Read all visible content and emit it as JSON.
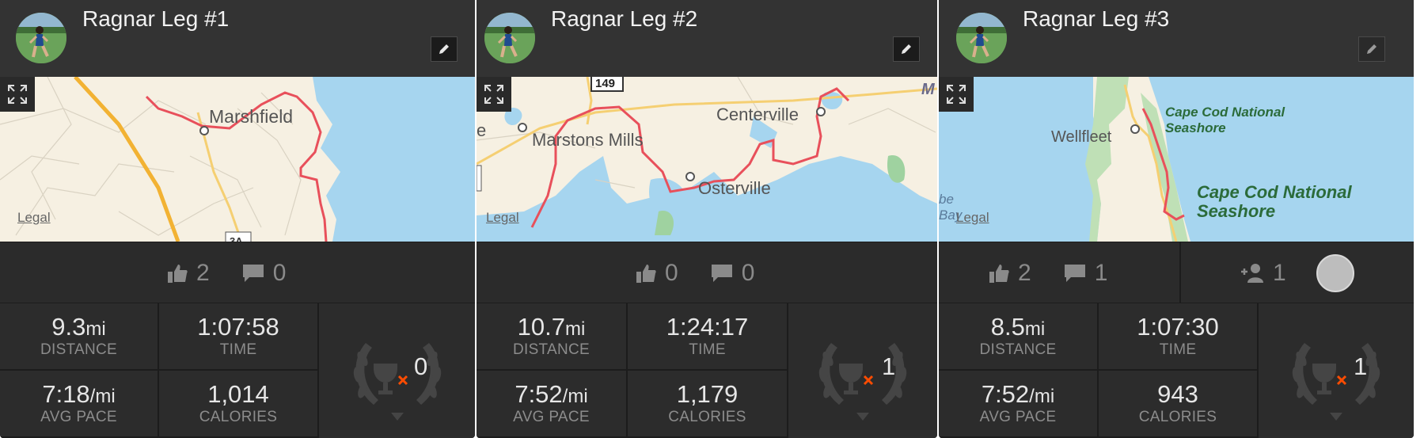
{
  "cards": [
    {
      "title": "Ragnar Leg #1",
      "likes": "2",
      "comments": "0",
      "distance_value": "9.3",
      "distance_unit": "mi",
      "distance_label": "DISTANCE",
      "time_value": "1:07:58",
      "time_label": "TIME",
      "pace_value": "7:18",
      "pace_unit": "/mi",
      "pace_label": "AVG PACE",
      "calories_value": "1,014",
      "calories_label": "CALORIES",
      "achievements": "0",
      "map_labels": {
        "legal": "Legal",
        "town": "Marshfield",
        "route_sign": "3A"
      }
    },
    {
      "title": "Ragnar Leg #2",
      "likes": "0",
      "comments": "0",
      "distance_value": "10.7",
      "distance_unit": "mi",
      "distance_label": "DISTANCE",
      "time_value": "1:24:17",
      "time_label": "TIME",
      "pace_value": "7:52",
      "pace_unit": "/mi",
      "pace_label": "AVG PACE",
      "calories_value": "1,179",
      "calories_label": "CALORIES",
      "achievements": "1",
      "map_labels": {
        "legal": "Legal",
        "town1": "Marstons Mills",
        "town2": "Centerville",
        "town3": "Osterville",
        "route_sign": "149",
        "edge_left": "e",
        "edge_right": "M"
      }
    },
    {
      "title": "Ragnar Leg #3",
      "likes": "2",
      "comments": "1",
      "followers": "1",
      "distance_value": "8.5",
      "distance_unit": "mi",
      "distance_label": "DISTANCE",
      "time_value": "1:07:30",
      "time_label": "TIME",
      "pace_value": "7:52",
      "pace_unit": "/mi",
      "pace_label": "AVG PACE",
      "calories_value": "943",
      "calories_label": "CALORIES",
      "achievements": "1",
      "map_labels": {
        "legal": "Legal",
        "town": "Wellfleet",
        "park_small_1": "Cape Cod National",
        "park_small_2": "Seashore",
        "park_large_1": "Cape Cod National",
        "park_large_2": "Seashore",
        "bay_1": "be",
        "bay_2": "Bay"
      }
    }
  ],
  "icons": {
    "like": "thumbs-up-icon",
    "comment": "speech-bubble-icon",
    "edit": "pencil-icon",
    "expand": "expand-arrows-icon",
    "trophy": "trophy-laurel-icon",
    "follow": "add-person-icon"
  },
  "colors": {
    "card_bg": "#2e2e2e",
    "route": "#e8505b",
    "water": "#a6d5ef",
    "land": "#f6f0e2",
    "accent_x": "#fc4c02"
  }
}
